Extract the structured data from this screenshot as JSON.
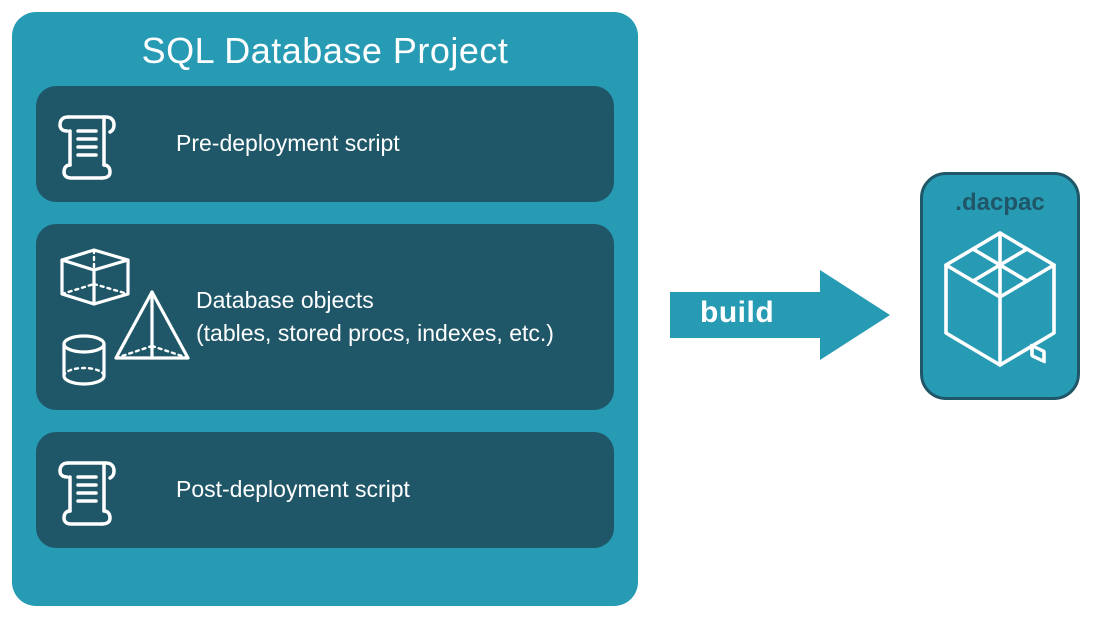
{
  "colors": {
    "panel_bg": "#279BB4",
    "stage_bg": "#1F5768",
    "stroke": "#ffffff"
  },
  "project": {
    "title": "SQL Database Project",
    "stages": [
      {
        "label": "Pre-deployment script",
        "icon": "scroll-icon"
      },
      {
        "label_line1": "Database objects",
        "label_line2": "(tables, stored procs, indexes, etc.)",
        "icon": "db-objects-icon"
      },
      {
        "label": "Post-deployment script",
        "icon": "scroll-icon"
      }
    ]
  },
  "arrow": {
    "label": "build"
  },
  "output": {
    "label": ".dacpac",
    "icon": "package-icon"
  }
}
